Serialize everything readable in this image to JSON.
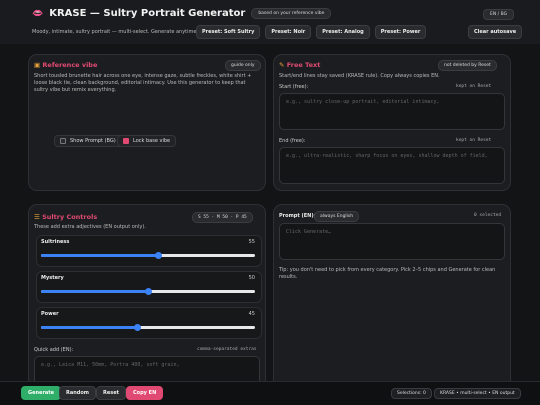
{
  "header": {
    "logo_icon": "lips-icon",
    "title": "KRASE — Sultry Portrait Generator",
    "ref_chip": "based on your reference vibe",
    "lang_button": "EN / BG",
    "subtitle": "Moody, intimate, sultry portrait — multi-select. Generate anytime.",
    "presets": [
      "Preset: Soft Sultry",
      "Preset: Noir",
      "Preset: Analog",
      "Preset: Power"
    ],
    "clear": "Clear autosave"
  },
  "reference": {
    "icon": "image-icon",
    "title": "Reference vibe",
    "badge": "guide only",
    "text": "Short tousled brunette hair across one eye, intense gaze, subtle freckles, white shirt + loose black tie, clean background, editorial intimacy. Use this generator to keep that sultry vibe but remix everything.",
    "show_prompt_label": "Show Prompt (BG) too",
    "show_prompt_checked": false,
    "lock_label": "Lock base vibe",
    "lock_checked": true
  },
  "free_text": {
    "icon": "pencil-icon",
    "title": "Free Text",
    "badge": "not deleted by Reset",
    "desc": "Start/end lines stay saved (KRASE rule). Copy always copies EN.",
    "start_label": "Start (free):",
    "start_hint": "kept on Reset",
    "start_placeholder": "e.g., sultry close-up portrait, editorial intimacy,",
    "end_label": "End (free):",
    "end_hint": "kept on Reset",
    "end_placeholder": "e.g., ultra-realistic, sharp focus on eyes, shallow depth of field,"
  },
  "controls": {
    "icon": "sliders-icon",
    "title": "Sultry Controls",
    "readout": "S 55 · M 50 · P 45",
    "desc": "These add extra adjectives (EN output only).",
    "sliders": [
      {
        "name": "Sultriness",
        "value": 55,
        "display": "55"
      },
      {
        "name": "Mystery",
        "value": 50,
        "display": "50"
      },
      {
        "name": "Power",
        "value": 45,
        "display": "45"
      }
    ],
    "quick_label": "Quick add (EN):",
    "quick_hint": "comma-separated extras",
    "quick_placeholder": "e.g., Leica M11, 50mm, Portra 400, soft grain,"
  },
  "prompt": {
    "label": "Prompt (EN):",
    "chip": "always English",
    "selected": "0 selected",
    "placeholder": "Click Generate…",
    "tip": "Tip: you don't need to pick from every category. Pick 2–5 chips and Generate for clean results."
  },
  "footer": {
    "generate": "Generate",
    "random": "Random",
    "reset": "Reset",
    "copy": "Copy EN",
    "selections": "Selections: 0",
    "mode": "KRASE • multi-select • EN output"
  },
  "colors": {
    "accent_pink": "#e04a72",
    "generate_green": "#2fae6a",
    "slider_blue": "#3b82f6"
  }
}
